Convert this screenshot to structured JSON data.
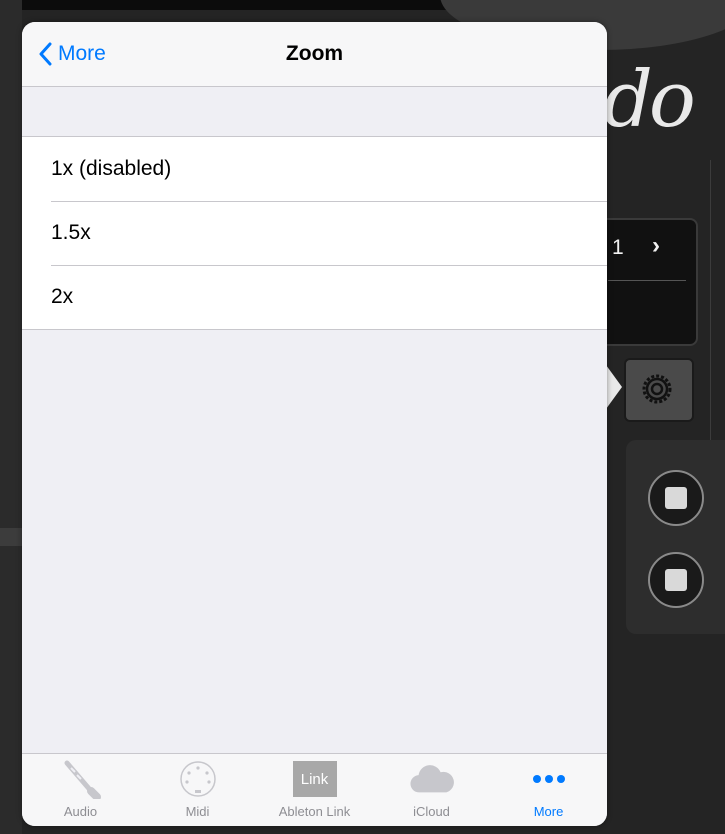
{
  "background": {
    "logo_text": "do",
    "panel_value": "1",
    "panel_chevron": "›"
  },
  "navbar": {
    "back_label": "More",
    "title": "Zoom"
  },
  "zoom_options": [
    {
      "label": "1x (disabled)"
    },
    {
      "label": "1.5x"
    },
    {
      "label": "2x"
    }
  ],
  "tabbar": {
    "tabs": [
      {
        "label": "Audio",
        "icon": "audio-jack-icon",
        "active": false
      },
      {
        "label": "Midi",
        "icon": "midi-connector-icon",
        "active": false
      },
      {
        "label": "Ableton Link",
        "icon": "ableton-link-icon",
        "icon_text": "Link",
        "active": false
      },
      {
        "label": "iCloud",
        "icon": "cloud-icon",
        "active": false
      },
      {
        "label": "More",
        "icon": "more-dots-icon",
        "active": true
      }
    ]
  },
  "colors": {
    "accent": "#007aff",
    "inactive": "#8e8e93"
  }
}
